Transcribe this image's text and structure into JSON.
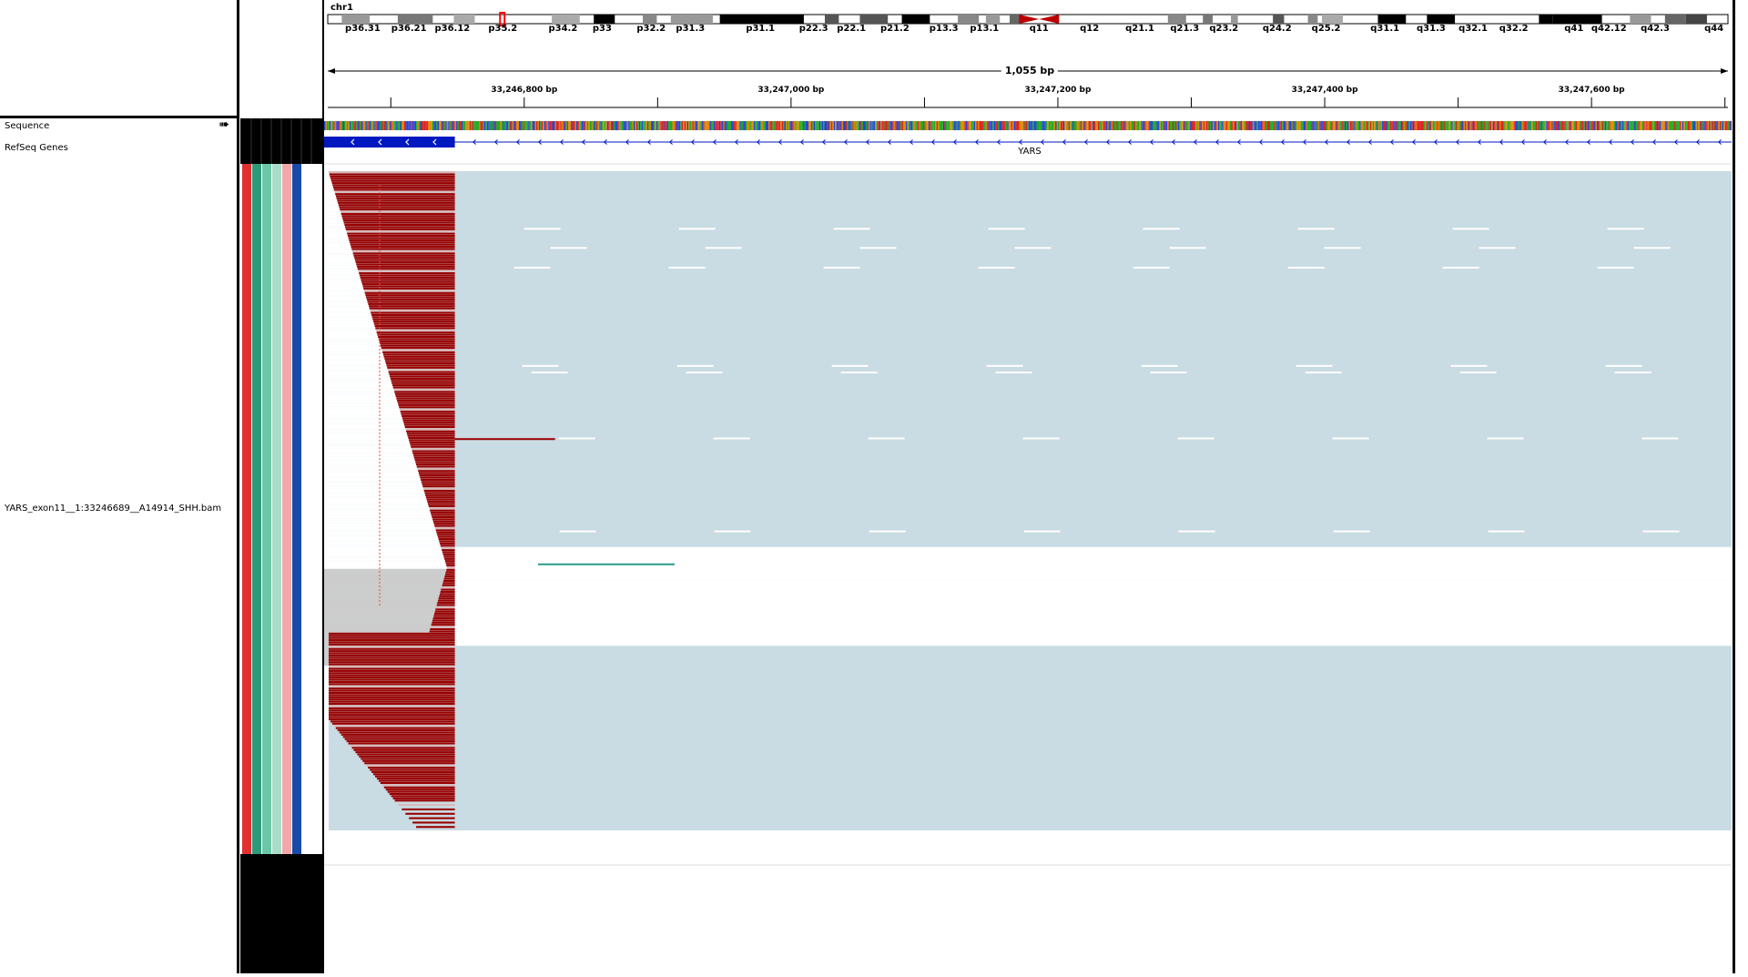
{
  "genome": {
    "chromosome": "chr1",
    "span": "1,055 bp"
  },
  "ideogram_bands": [
    {
      "label": "p36.31",
      "pos": 0.025
    },
    {
      "label": "p36.21",
      "pos": 0.058
    },
    {
      "label": "p36.12",
      "pos": 0.089
    },
    {
      "label": "p35.2",
      "pos": 0.125
    },
    {
      "label": "p34.2",
      "pos": 0.168
    },
    {
      "label": "p33",
      "pos": 0.196
    },
    {
      "label": "p32.2",
      "pos": 0.231
    },
    {
      "label": "p31.3",
      "pos": 0.259
    },
    {
      "label": "p31.1",
      "pos": 0.309
    },
    {
      "label": "p22.3",
      "pos": 0.347
    },
    {
      "label": "p22.1",
      "pos": 0.374
    },
    {
      "label": "p21.2",
      "pos": 0.405
    },
    {
      "label": "p13.3",
      "pos": 0.44
    },
    {
      "label": "p13.1",
      "pos": 0.469
    },
    {
      "label": "q11",
      "pos": 0.508
    },
    {
      "label": "q12",
      "pos": 0.544
    },
    {
      "label": "q21.1",
      "pos": 0.58
    },
    {
      "label": "q21.3",
      "pos": 0.612
    },
    {
      "label": "q23.2",
      "pos": 0.64
    },
    {
      "label": "q24.2",
      "pos": 0.678
    },
    {
      "label": "q25.2",
      "pos": 0.713
    },
    {
      "label": "q31.1",
      "pos": 0.755
    },
    {
      "label": "q31.3",
      "pos": 0.788
    },
    {
      "label": "q32.1",
      "": "",
      "pos": 0.818
    },
    {
      "label": "q32.2",
      "pos": 0.847
    },
    {
      "label": "q41",
      "pos": 0.89
    },
    {
      "label": "q42.12",
      "pos": 0.915
    },
    {
      "label": "q42.3",
      "pos": 0.948
    },
    {
      "label": "q44",
      "pos": 0.99
    }
  ],
  "ruler": {
    "ticks": [
      {
        "label": "33,246,800 bp",
        "bp": 33246800
      },
      {
        "label": "33,247,000 bp",
        "bp": 33247000
      },
      {
        "label": "33,247,200 bp",
        "bp": 33247200
      },
      {
        "label": "33,247,400 bp",
        "bp": 33247400
      },
      {
        "label": "33,247,600 bp",
        "bp": 33247600
      }
    ],
    "view_start_bp": 33246650,
    "view_end_bp": 33247705
  },
  "tracks": {
    "sequence_label": "Sequence",
    "refseq_label": "RefSeq Genes",
    "gene_name": "YARS",
    "bam_label": "YARS_exon11__1:33246689__A14914_SHH.bam"
  },
  "attribute_colors": [
    "#e03030",
    "#2e9a7a",
    "#6cc7a8",
    "#a8dcc8",
    "#f2a8a8",
    "#1a4aa8",
    "#ffffff"
  ],
  "colors": {
    "softclip": "#990000",
    "read": "#c9dbe3",
    "read_alt": "#bfbfbf",
    "gene": "#0018c0",
    "mismatch_purple": "#7030e0"
  },
  "alignment": {
    "clip_end_bp": 33246748,
    "read_rows": 300
  }
}
